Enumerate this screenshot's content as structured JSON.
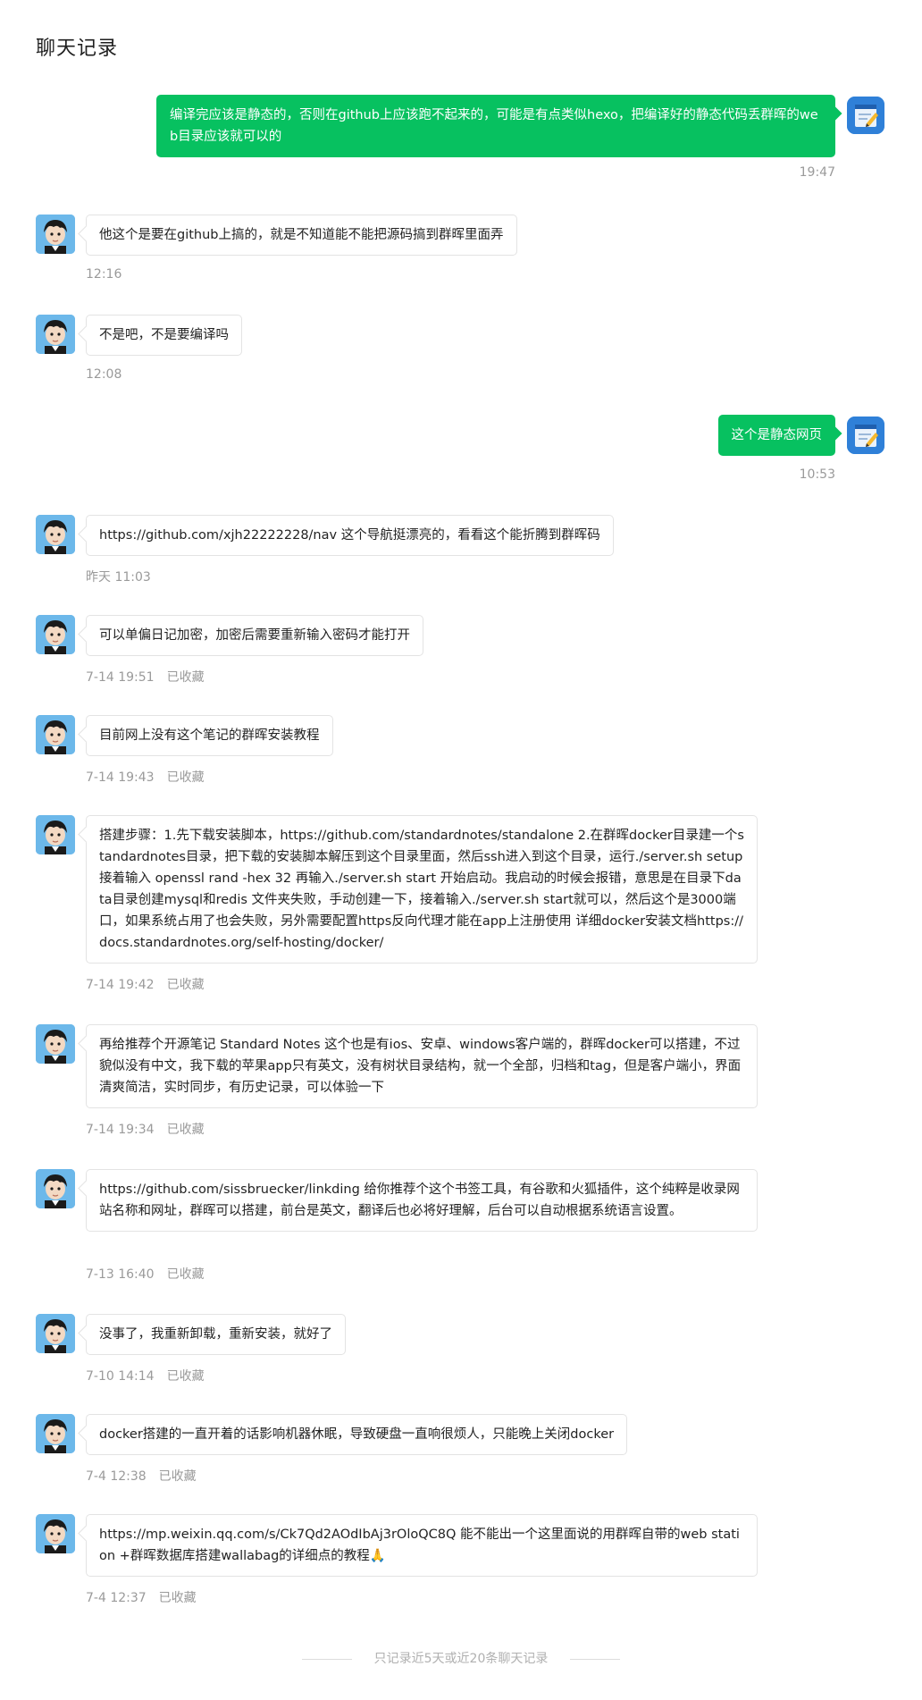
{
  "page_title": "聊天记录",
  "colors": {
    "self_bubble": "#07c160",
    "other_bubble": "#ffffff",
    "meta_text": "#9a9a9a"
  },
  "icons": {
    "other_avatar": "cartoon-boy-avatar",
    "self_avatar": "notepad-pencil-avatar"
  },
  "messages": [
    {
      "from": "self",
      "text": "编译完应该是静态的，否则在github上应该跑不起来的，可能是有点类似hexo，把编译好的静态代码丢群晖的web目录应该就可以的",
      "time": "19:47",
      "fav": ""
    },
    {
      "from": "other",
      "text": "他这个是要在github上搞的，就是不知道能不能把源码搞到群晖里面弄",
      "time": "12:16",
      "fav": ""
    },
    {
      "from": "other",
      "text": "不是吧，不是要编译吗",
      "time": "12:08",
      "fav": ""
    },
    {
      "from": "self",
      "text": "这个是静态网页",
      "time": "10:53",
      "fav": ""
    },
    {
      "from": "other",
      "text": "https://github.com/xjh22222228/nav 这个导航挺漂亮的，看看这个能折腾到群晖码",
      "time": "昨天 11:03",
      "fav": ""
    },
    {
      "from": "other",
      "text": "可以单偏日记加密，加密后需要重新输入密码才能打开",
      "time": "7-14 19:51",
      "fav": "已收藏"
    },
    {
      "from": "other",
      "text": "目前网上没有这个笔记的群晖安装教程",
      "time": "7-14 19:43",
      "fav": "已收藏"
    },
    {
      "from": "other",
      "text": "搭建步骤：1.先下载安装脚本，https://github.com/standardnotes/standalone 2.在群晖docker目录建一个standardnotes目录，把下载的安装脚本解压到这个目录里面，然后ssh进入到这个目录，运行./server.sh setup 接着输入 openssl rand -hex 32 再输入./server.sh start 开始启动。我启动的时候会报错，意思是在目录下data目录创建mysql和redis 文件夹失败，手动创建一下，接着输入./server.sh start就可以，然后这个是3000端口，如果系统占用了也会失败，另外需要配置https反向代理才能在app上注册使用 详细docker安装文档https://docs.standardnotes.org/self-hosting/docker/",
      "time": "7-14 19:42",
      "fav": "已收藏"
    },
    {
      "from": "other",
      "text": "再给推荐个开源笔记 Standard Notes 这个也是有ios、安卓、windows客户端的，群晖docker可以搭建，不过貌似没有中文，我下载的苹果app只有英文，没有树状目录结构，就一个全部，归档和tag，但是客户端小，界面清爽简洁，实时同步，有历史记录，可以体验一下",
      "time": "7-14 19:34",
      "fav": "已收藏"
    },
    {
      "from": "other",
      "text": "https://github.com/sissbruecker/linkding 给你推荐个这个书签工具，有谷歌和火狐插件，这个纯粹是收录网站名称和网址，群晖可以搭建，前台是英文，翻译后也必将好理解，后台可以自动根据系统语言设置。",
      "time": "7-13 16:40",
      "fav": "已收藏"
    },
    {
      "from": "other",
      "text": "没事了，我重新卸载，重新安装，就好了",
      "time": "7-10 14:14",
      "fav": "已收藏"
    },
    {
      "from": "other",
      "text": "docker搭建的一直开着的话影响机器休眠，导致硬盘一直响很烦人，只能晚上关闭docker",
      "time": "7-4 12:38",
      "fav": "已收藏"
    },
    {
      "from": "other",
      "text": "https://mp.weixin.qq.com/s/Ck7Qd2AOdIbAj3rOloQC8Q 能不能出一个这里面说的用群晖自带的web station +群晖数据库搭建wallabag的详细点的教程🙏",
      "time": "7-4 12:37",
      "fav": "已收藏"
    }
  ],
  "footer": "只记录近5天或近20条聊天记录"
}
